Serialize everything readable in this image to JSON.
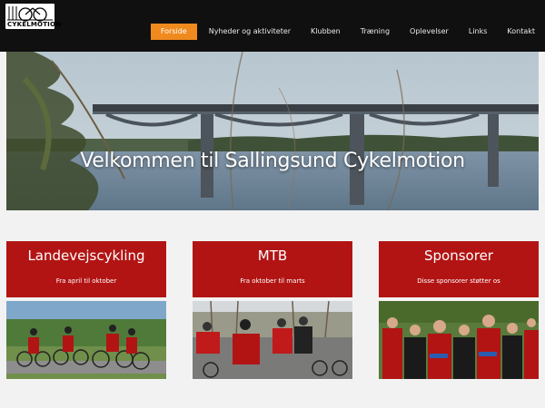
{
  "header": {
    "logo_text": "CYKELMOTION",
    "nav": [
      {
        "label": "Forside",
        "active": true
      },
      {
        "label": "Nyheder og aktiviteter",
        "active": false
      },
      {
        "label": "Klubben",
        "active": false
      },
      {
        "label": "Træning",
        "active": false
      },
      {
        "label": "Oplevelser",
        "active": false
      },
      {
        "label": "Links",
        "active": false
      },
      {
        "label": "Kontakt",
        "active": false
      }
    ]
  },
  "hero": {
    "title": "Velkommen til Sallingsund Cykelmotion"
  },
  "cards": [
    {
      "title": "Landevejscykling",
      "subtitle": "Fra april til oktober"
    },
    {
      "title": "MTB",
      "subtitle": "Fra oktober til marts"
    },
    {
      "title": "Sponsorer",
      "subtitle": "Disse sponsorer støtter os"
    }
  ],
  "colors": {
    "accent": "#f08a1e",
    "card": "#b21414",
    "topbar": "#101010"
  }
}
